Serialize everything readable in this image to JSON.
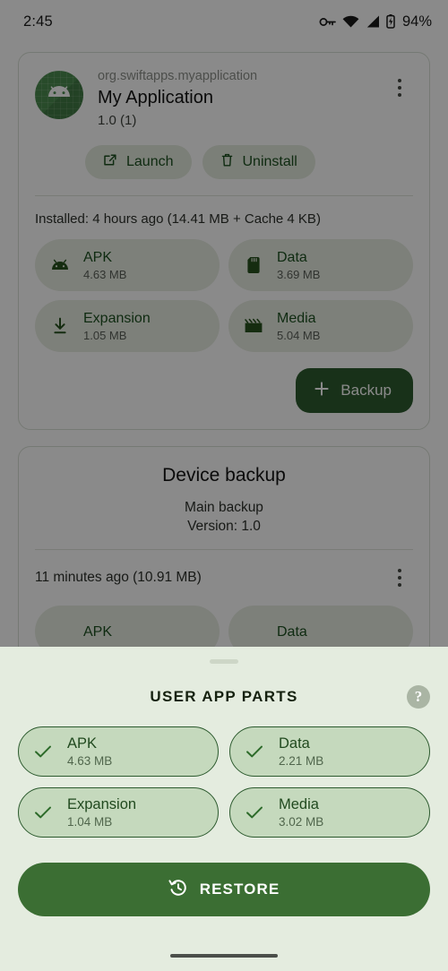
{
  "status_bar": {
    "time": "2:45",
    "battery_percent": "94%",
    "icons": [
      "vpn-key-icon",
      "wifi-icon",
      "signal-icon",
      "battery-icon"
    ]
  },
  "app_card": {
    "package_name": "org.swiftapps.myapplication",
    "app_name": "My Application",
    "version": "1.0 (1)",
    "icon": "android-robot-icon",
    "overflow_label": "more-options",
    "actions": [
      {
        "label": "Launch",
        "icon": "open-in-new-icon"
      },
      {
        "label": "Uninstall",
        "icon": "trash-icon"
      }
    ],
    "installed_line": "Installed: 4 hours ago (14.41 MB + Cache 4 KB)",
    "parts": [
      {
        "name": "APK",
        "size": "4.63 MB",
        "icon": "android-icon"
      },
      {
        "name": "Data",
        "size": "3.69 MB",
        "icon": "sd-card-icon"
      },
      {
        "name": "Expansion",
        "size": "1.05 MB",
        "icon": "download-icon"
      },
      {
        "name": "Media",
        "size": "5.04 MB",
        "icon": "movie-icon"
      }
    ],
    "backup_button": {
      "label": "Backup",
      "icon": "plus-icon"
    }
  },
  "device_backup_card": {
    "title": "Device backup",
    "subtitle": "Main backup",
    "version": "Version: 1.0",
    "backup_when": "11 minutes ago (10.91 MB)",
    "overflow_label": "more-options",
    "clipped_parts": [
      {
        "name": "APK"
      },
      {
        "name": "Data"
      }
    ]
  },
  "sheet": {
    "title": "USER APP PARTS",
    "help_icon": "help-icon",
    "help_glyph": "?",
    "handle": "drag-handle",
    "parts": [
      {
        "name": "APK",
        "size": "4.63 MB",
        "checked": true
      },
      {
        "name": "Data",
        "size": "2.21 MB",
        "checked": true
      },
      {
        "name": "Expansion",
        "size": "1.04 MB",
        "checked": true
      },
      {
        "name": "Media",
        "size": "3.02 MB",
        "checked": true
      }
    ],
    "restore_button": {
      "label": "RESTORE",
      "icon": "restore-history-icon"
    }
  },
  "nav_bar": {
    "pill": "gesture-nav-pill"
  },
  "colors": {
    "sheet_background": "#e4ecdf",
    "chip_fill": "#c5d9bd",
    "chip_outline": "#2d5b2f",
    "primary_green": "#3b6e33",
    "fab_green": "#2d5b2f",
    "accent_text": "#1c5020"
  }
}
